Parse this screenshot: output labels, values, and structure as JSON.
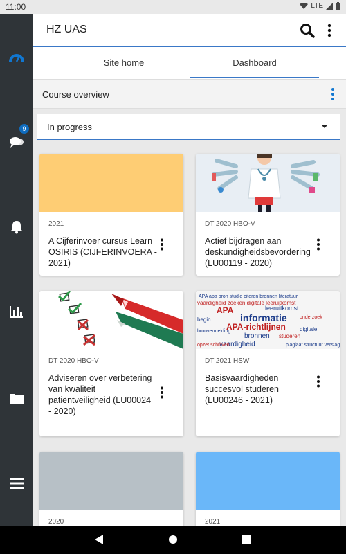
{
  "status_bar": {
    "time": "11:00",
    "network": "LTE"
  },
  "app_bar": {
    "title": "HZ UAS"
  },
  "tabs": [
    {
      "label": "Site home",
      "active": false
    },
    {
      "label": "Dashboard",
      "active": true
    }
  ],
  "section": {
    "title": "Course overview"
  },
  "filter": {
    "selected": "In progress"
  },
  "rail": {
    "messages_badge": "9"
  },
  "courses": [
    {
      "category": "2021",
      "name": "A Cijferinvoer cursus Learn OSIRIS (CIJFERINVOERA - 2021)",
      "image": "solid",
      "image_color": "#fecd74"
    },
    {
      "category": "DT 2020 HBO-V",
      "name": "Actief bijdragen aan deskundigheidsbevordering (LU00119 - 2020)",
      "image": "illustration-doctor",
      "image_color": "#e8eef4"
    },
    {
      "category": "DT 2020 HBO-V",
      "name": "Adviseren over verbetering van kwaliteit patiëntveiligheid (LU00024 - 2020)",
      "image": "illustration-checklist-marker",
      "image_color": "#ffffff"
    },
    {
      "category": "DT 2021 HSW",
      "name": "Basisvaardigheden succesvol studeren (LU00246 - 2021)",
      "image": "illustration-word-cloud",
      "image_color": "#f5f5f5"
    },
    {
      "category": "2020",
      "name": "",
      "image": "solid",
      "image_color": "#b7c0c6"
    },
    {
      "category": "2021",
      "name": "",
      "image": "solid",
      "image_color": "#6ab7f9"
    }
  ],
  "word_cloud": [
    "APA",
    "informatie",
    "APA-richtlijnen",
    "bronnen",
    "leeruitkomst",
    "vaardigheid",
    "digitale",
    "studeren",
    "begin"
  ],
  "colors": {
    "accent": "#3a78c7",
    "rail": "#2f3438",
    "rail_active": "#1177d1",
    "badge": "#0f6cbf"
  }
}
